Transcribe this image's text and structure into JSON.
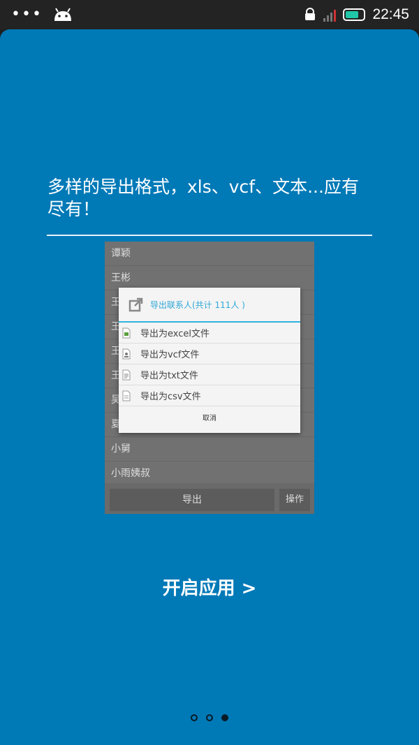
{
  "status_bar": {
    "dots": "•••",
    "time": "22:45"
  },
  "headline": "多样的导出格式，xls、vcf、文本...应有尽有！",
  "preview": {
    "contacts": [
      "谭颖",
      "王彬",
      "王",
      "王",
      "王",
      "王",
      "吴",
      "夏",
      "小舅",
      "小雨姨叔"
    ],
    "export_button": "导出",
    "operate_button": "操作",
    "dialog": {
      "title": "导出联系人(共计 111人 )",
      "options": [
        {
          "label": "导出为excel文件",
          "icon": "excel-file-icon"
        },
        {
          "label": "导出为vcf文件",
          "icon": "vcf-file-icon"
        },
        {
          "label": "导出为txt文件",
          "icon": "txt-file-icon"
        },
        {
          "label": "导出为csv文件",
          "icon": "csv-file-icon"
        }
      ],
      "cancel": "取消"
    }
  },
  "start_button": "开启应用 >",
  "pager": {
    "count": 3,
    "active": 2
  },
  "colors": {
    "background": "#0079b7",
    "accent": "#2fb3df",
    "statusbar": "#232323"
  }
}
